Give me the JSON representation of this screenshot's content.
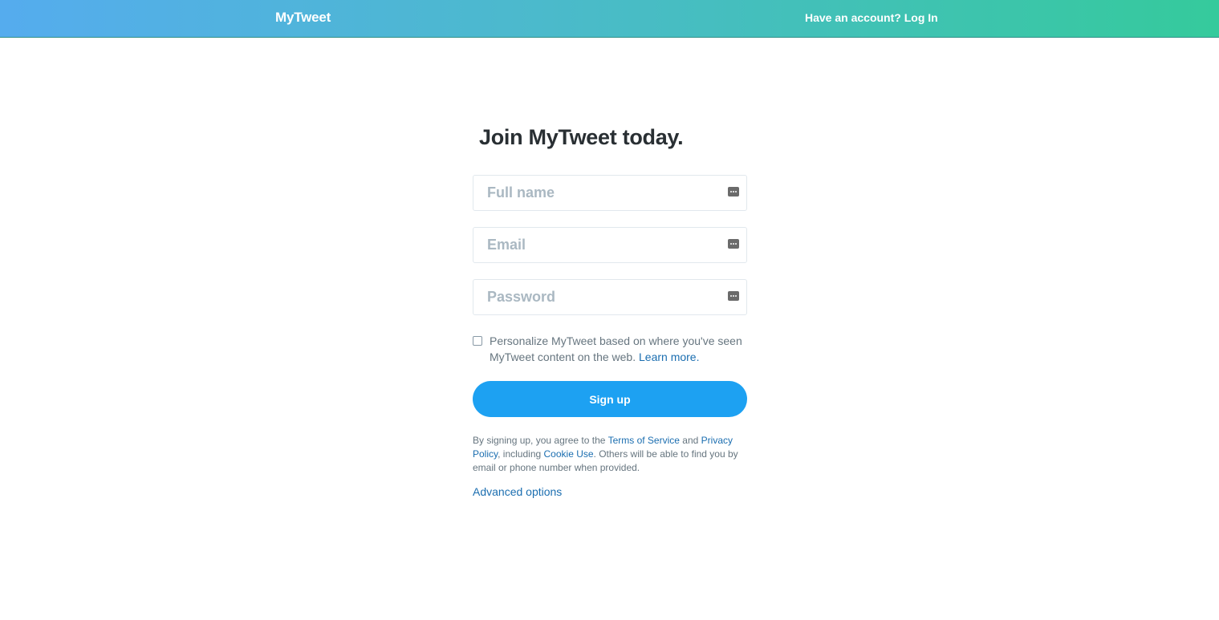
{
  "header": {
    "brand": "MyTweet",
    "account_prompt": "Have an account?",
    "login_label": "Log In"
  },
  "signup": {
    "title": "Join MyTweet today.",
    "fields": {
      "full_name": {
        "placeholder": "Full name",
        "value": ""
      },
      "email": {
        "placeholder": "Email",
        "value": ""
      },
      "password": {
        "placeholder": "Password",
        "value": ""
      }
    },
    "autofill_icon": "autofill-key-icon",
    "personalize": {
      "checked": false,
      "text": "Personalize MyTweet based on where you've seen MyTweet content on the web.",
      "learn_more": "Learn more."
    },
    "signup_button": "Sign up",
    "terms": {
      "prefix": "By signing up, you agree to the",
      "terms_link": "Terms of Service",
      "and": "and",
      "privacy_link": "Privacy Policy",
      "including": ", including",
      "cookie_link": "Cookie Use",
      "suffix": ". Others will be able to find you by email or phone number when provided."
    },
    "advanced_options": "Advanced options"
  },
  "colors": {
    "header_gradient_start": "#55acee",
    "header_gradient_end": "#35ca9c",
    "primary_button": "#1da1f2",
    "link": "#1b6eb0",
    "title_text": "#292f33",
    "muted_text": "#66757f",
    "placeholder": "#aab8c2"
  }
}
